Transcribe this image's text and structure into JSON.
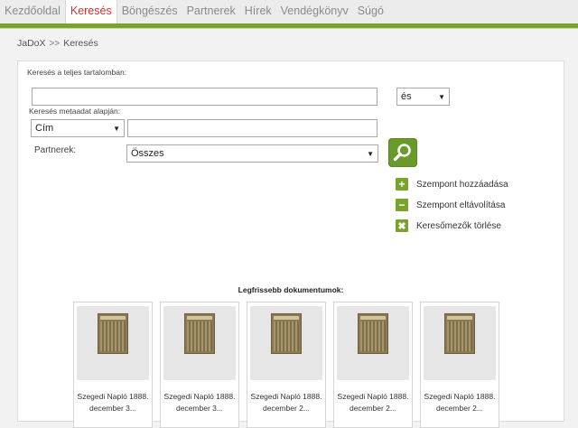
{
  "nav": {
    "tabs": [
      "Kezdőoldal",
      "Keresés",
      "Böngészés",
      "Partnerek",
      "Hírek",
      "Vendégkönyv",
      "Súgó"
    ],
    "active": 1
  },
  "breadcrumb": {
    "home": "JaDoX",
    "separator": ">>",
    "current": "Keresés"
  },
  "search": {
    "fulltext_label": "Keresés a teljes tartalomban:",
    "fulltext_value": "",
    "operator": "és",
    "metadata_label": "Keresés metaadat alapján:",
    "field": "Cím",
    "field_value": "",
    "partners_label": "Partnerek:",
    "partners_value": "Összes"
  },
  "actions": {
    "add": "Szempont hozzáadása",
    "remove": "Szempont eltávolítása",
    "clear": "Keresőmezők törlése"
  },
  "latest": {
    "title": "Legfrissebb dokumentumok:",
    "items": [
      {
        "line1": "Szegedi Napló 1888.",
        "line2": "december 3..."
      },
      {
        "line1": "Szegedi Napló 1888.",
        "line2": "december 3..."
      },
      {
        "line1": "Szegedi Napló 1888.",
        "line2": "december 2..."
      },
      {
        "line1": "Szegedi Napló 1888.",
        "line2": "december 2..."
      },
      {
        "line1": "Szegedi Napló 1888.",
        "line2": "december 2..."
      }
    ]
  },
  "colors": {
    "accent": "#7aa32b",
    "active_tab": "#d0302a"
  }
}
